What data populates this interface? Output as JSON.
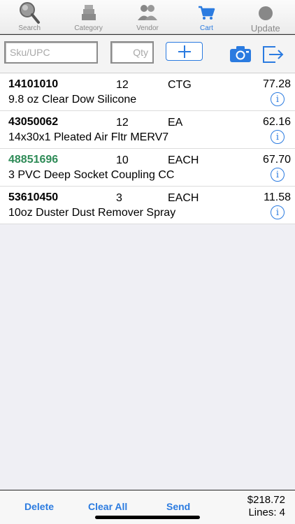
{
  "tabs": [
    {
      "label": "Search",
      "icon": "search-icon"
    },
    {
      "label": "Category",
      "icon": "category-icon"
    },
    {
      "label": "Vendor",
      "icon": "vendor-icon"
    },
    {
      "label": "Cart",
      "icon": "cart-icon",
      "active": true
    },
    {
      "label": "Update",
      "icon": "update-icon"
    }
  ],
  "input_bar": {
    "sku_placeholder": "Sku/UPC",
    "qty_placeholder": "Qty",
    "add_label": "+"
  },
  "items": [
    {
      "sku": "14101010",
      "qty": "12",
      "unit": "CTG",
      "price": "77.28",
      "description": "9.8 oz Clear Dow Silicone"
    },
    {
      "sku": "43050062",
      "qty": "12",
      "unit": "EA",
      "price": "62.16",
      "description": "14x30x1 Pleated Air Fltr MERV7"
    },
    {
      "sku": "48851696",
      "qty": "10",
      "unit": "EACH",
      "price": "67.70",
      "description": "3 PVC Deep Socket Coupling CC",
      "highlight": true
    },
    {
      "sku": "53610450",
      "qty": "3",
      "unit": "EACH",
      "price": "11.58",
      "description": "10oz Duster Dust Remover Spray"
    }
  ],
  "info_glyph": "i",
  "bottom_bar": {
    "delete_label": "Delete",
    "clear_all_label": "Clear All",
    "send_label": "Send",
    "total": "$218.72",
    "lines": "Lines: 4"
  },
  "colors": {
    "accent": "#2b7be0",
    "highlight_sku": "#2e8b57"
  }
}
